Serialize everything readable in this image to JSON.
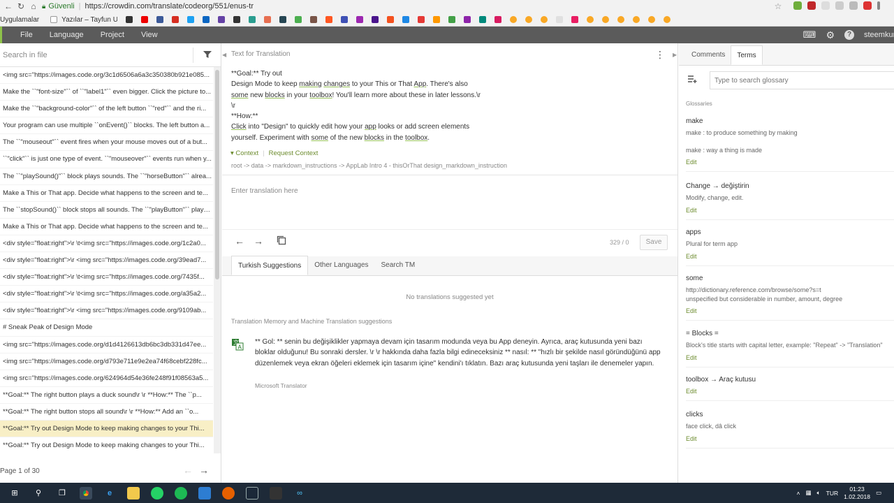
{
  "browser": {
    "secure_label": "Güvenli",
    "url": "https://crowdin.com/translate/codeorg/551/enus-tr",
    "bookmarks": [
      "Uygulamalar",
      "Yazılar – Tayfun Uzun"
    ]
  },
  "menubar": {
    "items": [
      "File",
      "Language",
      "Project",
      "View"
    ],
    "user": "steemkur"
  },
  "left": {
    "search_placeholder": "Search in file",
    "strings": [
      "<img src=\"https://images.code.org/3c1d6506a6a3c350380b921e085...",
      "Make the ``\"font-size\"`` of ``\"label1\"`` even bigger. Click the picture to...",
      "Make the ``\"background-color\"`` of the left button ``\"red\"`` and the ri...",
      "Your program can use multiple ``onEvent()`` blocks. The left button a...",
      "The ``\"mouseout\"`` event fires when your mouse moves out of a but...",
      "``\"click\"`` is just one type of event. ``\"mouseover\"`` events run when y...",
      "The ``\"playSound()\"`` block plays sounds. The ``\"horseButton\"`` alrea...",
      "Make a This or That app. Decide what happens to the screen and te...",
      "The ``stopSound()`` block stops all sounds. The ``\"playButton\"`` plays ...",
      "Make a This or That app. Decide what happens to the screen and te...",
      "<div style=\"float:right\">\\r \\t<img src=\"https://images.code.org/1c2a0...",
      "<div style=\"float:right\">\\r <img src=\"https://images.code.org/39ead7...",
      "<div style=\"float:right\">\\r \\t<img src=\"https://images.code.org/7435f...",
      "<div style=\"float:right\">\\r \\t<img src=\"https://images.code.org/a35a2...",
      "<div style=\"float:right\">\\r <img src=\"https://images.code.org/9109ab...",
      "# Sneak Peak of Design Mode",
      "<img src=\"https://images.code.org/d1d4126613db6bc3db331d47ee...",
      "<img src=\"https://images.code.org/d793e711e9e2ea74f68cebf228fc...",
      "<img src=\"https://images.code.org/624964d54e36fe248f91f08563a5...",
      "**Goal:** The right button plays a duck sound\\r \\r **How:** The ``p...",
      "**Goal:** The right button stops all sound\\r \\r **How:** Add an ``o...",
      "**Goal:** Try out Design Mode to keep making changes to your Thi...",
      "**Goal:** Try out Design Mode to keep making changes to your Thi..."
    ],
    "active_index": 21,
    "page_label": "Page 1 of 30"
  },
  "center": {
    "header": "Text for Translation",
    "source": {
      "l1": "**Goal:** Try out",
      "l2a": "Design Mode to keep ",
      "l2b": "making",
      "l2c": " ",
      "l2d": "changes",
      "l2e": " to your This or That ",
      "l2f": "App",
      "l2g": ". There's also",
      "l3a": "some",
      "l3b": " new ",
      "l3c": "blocks",
      "l3d": " in your ",
      "l3e": "toolbox",
      "l3f": "! You'll learn more about these in later lessons.\\r",
      "l4": "\\r",
      "l5": "**How:**",
      "l6a": "Click",
      "l6b": " into \"Design\" to quickly edit how your ",
      "l6c": "app",
      "l6d": " looks or add screen elements",
      "l7a": "yourself. Experiment with ",
      "l7b": "some",
      "l7c": " of the new ",
      "l7d": "blocks",
      "l7e": " in the ",
      "l7f": "toolbox",
      "l7g": "."
    },
    "context_label": "Context",
    "request_context": "Request Context",
    "path": "root -> data -> markdown_instructions -> AppLab Intro 4 - thisOrThat design_markdown_instruction",
    "translation_placeholder": "Enter translation here",
    "counter": "329 / 0",
    "save_label": "Save",
    "tabs": [
      "Turkish Suggestions",
      "Other Languages",
      "Search TM"
    ],
    "no_suggestions": "No translations suggested yet",
    "tm_header": "Translation Memory and Machine Translation suggestions",
    "suggestion_text": "** Gol: ** senin bu değişiklikler yapmaya devam için tasarım modunda veya bu App deneyin. Ayrıca, araç kutusunda yeni bazı bloklar olduğunu! Bu sonraki dersler. \\r \\r hakkında daha fazla bilgi edineceksiniz ** nasıl: ** \"hızlı bir şekilde nasıl göründüğünü app düzenlemek veya ekran öğeleri eklemek için tasarım içine\" kendini'ı tıklatın. Bazı araç kutusunda yeni taşları ile denemeler yapın.",
    "suggestion_source": "Microsoft Translator"
  },
  "right": {
    "tabs": [
      "Comments",
      "Terms"
    ],
    "glossary_placeholder": "Type to search glossary",
    "glossaries_label": "Glossaries",
    "edit_label": "Edit",
    "terms": [
      {
        "name": "make",
        "desc1": "make : to produce something by making",
        "desc2": "make : way a thing is made"
      },
      {
        "name": "Change → değiştirin",
        "desc1": "Modify, change, edit.",
        "desc2": ""
      },
      {
        "name": "apps",
        "desc1": "Plural for term app",
        "desc2": ""
      },
      {
        "name": "some",
        "desc1": "http://dictionary.reference.com/browse/some?s=t",
        "desc2": "unspecified but considerable in number, amount, degree"
      },
      {
        "name": "= Blocks =",
        "desc1": "Block's title starts with capital letter, example: \"Repeat\" -> \"Translation\"",
        "desc2": ""
      },
      {
        "name": "toolbox → Araç kutusu",
        "desc1": "",
        "desc2": ""
      },
      {
        "name": "clicks",
        "desc1": "face click, dâ click",
        "desc2": ""
      }
    ]
  },
  "taskbar": {
    "lang": "TUR",
    "time": "01:23",
    "date": "1.02.2018"
  }
}
